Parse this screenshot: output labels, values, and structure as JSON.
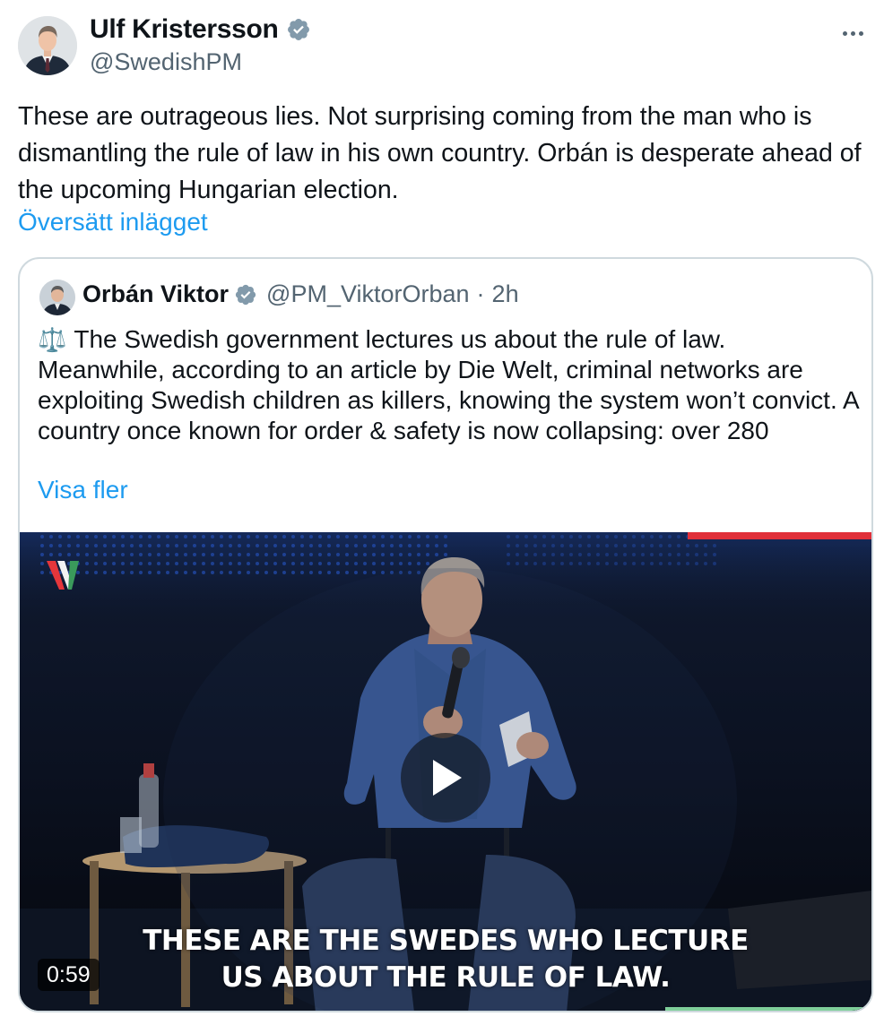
{
  "author": {
    "display_name": "Ulf Kristersson",
    "handle": "@SwedishPM",
    "verified": true
  },
  "tweet": {
    "text": "These are outrageous lies. Not surprising coming from the man who is dismantling the rule of law in his own country. Orbán is desperate ahead of the upcoming Hungarian election.",
    "translate_label": "Översätt inlägget"
  },
  "quoted": {
    "display_name": "Orbán Viktor",
    "handle": "@PM_ViktorOrban",
    "separator": "·",
    "time": "2h",
    "emoji": "⚖️",
    "text": "The Swedish government lectures us about the rule of law. Meanwhile, according to an article by Die Welt, criminal networks are exploiting Swedish children as killers, knowing the system won’t convict. A country once known for order & safety is now collapsing: over 280",
    "show_more_label": "Visa fler",
    "video": {
      "subtitle_line1": "THESE ARE THE SWEDES WHO LECTURE",
      "subtitle_line2": "US ABOUT THE RULE OF LAW.",
      "duration": "0:59"
    }
  },
  "icons": {
    "verified": "verified-badge-icon",
    "more": "more-options-icon",
    "play": "play-icon",
    "scale": "balance-scale-icon"
  },
  "colors": {
    "link": "#1d9bf0",
    "verified": "#829aab",
    "secondary_text": "#536471",
    "border": "#cfd9de"
  }
}
